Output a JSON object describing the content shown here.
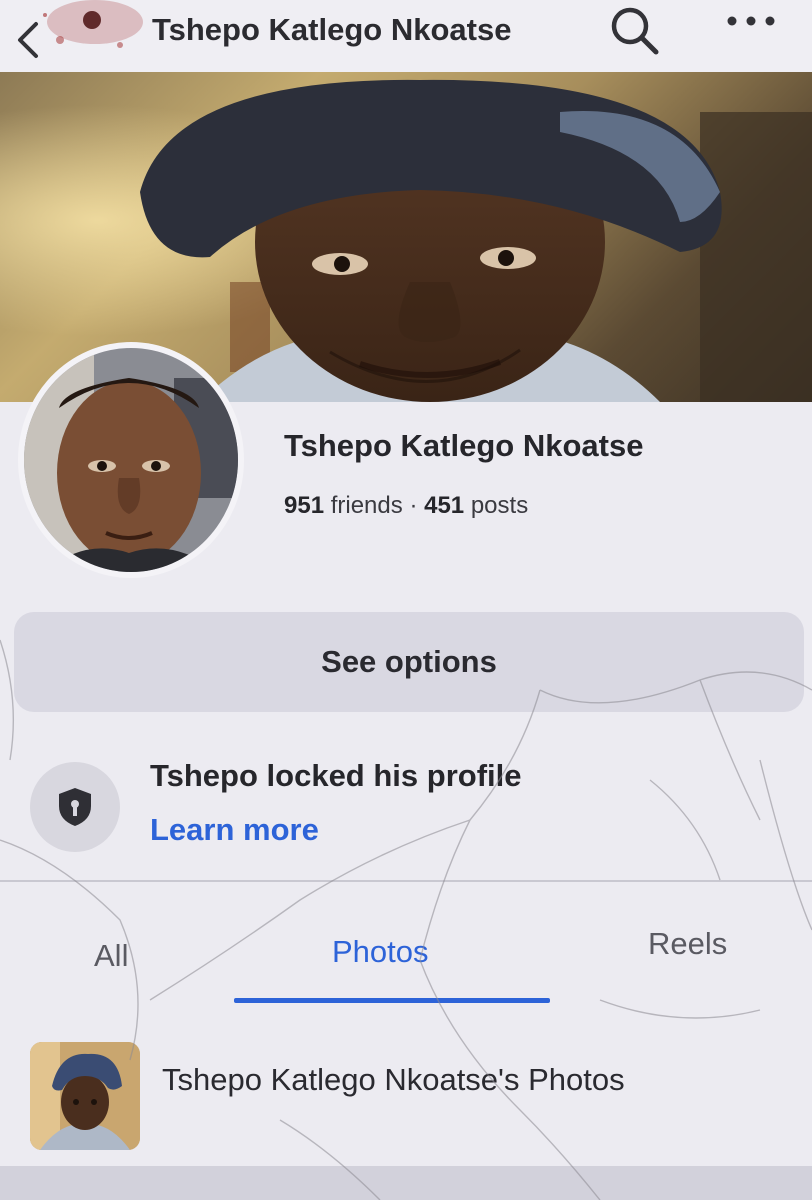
{
  "header": {
    "title": "Tshepo Katlego Nkoatse"
  },
  "profile": {
    "name": "Tshepo Katlego Nkoatse",
    "friends_count": "951",
    "friends_label": "friends",
    "separator": "·",
    "posts_count": "451",
    "posts_label": "posts"
  },
  "actions": {
    "see_options_label": "See options"
  },
  "lock_notice": {
    "title": "Tshepo locked his profile",
    "link_label": "Learn more"
  },
  "tabs": [
    {
      "label": "All",
      "active": false
    },
    {
      "label": "Photos",
      "active": true
    },
    {
      "label": "Reels",
      "active": false
    }
  ],
  "album": {
    "title": "Tshepo Katlego Nkoatse's Photos"
  },
  "colors": {
    "accent": "#2d63d8",
    "background": "#ecebf1",
    "button": "#d9d8e2"
  }
}
